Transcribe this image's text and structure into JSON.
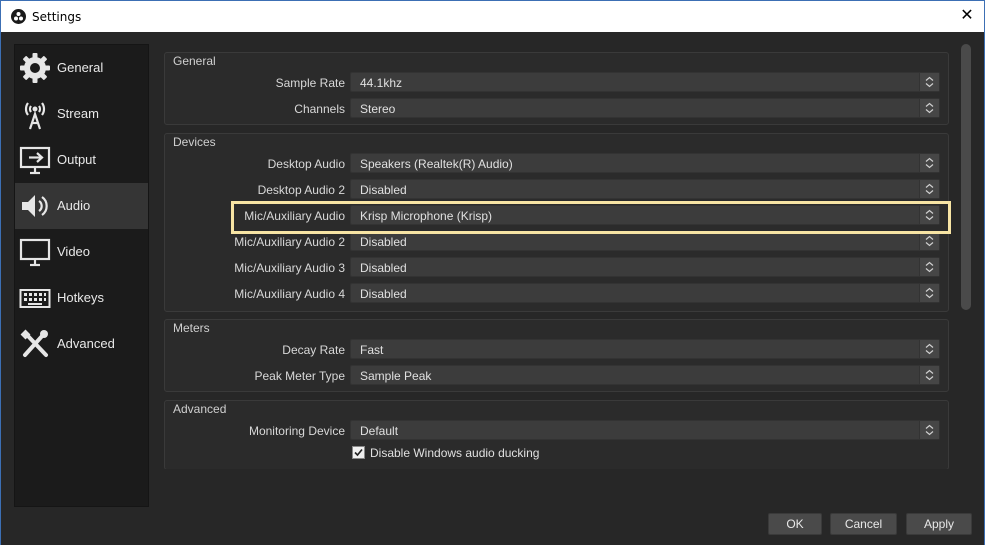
{
  "window": {
    "title": "Settings"
  },
  "sidebar": {
    "items": [
      {
        "label": "General",
        "icon": "gear-icon",
        "active": false
      },
      {
        "label": "Stream",
        "icon": "antenna-icon",
        "active": false
      },
      {
        "label": "Output",
        "icon": "output-icon",
        "active": false
      },
      {
        "label": "Audio",
        "icon": "speaker-icon",
        "active": true
      },
      {
        "label": "Video",
        "icon": "monitor-icon",
        "active": false
      },
      {
        "label": "Hotkeys",
        "icon": "keyboard-icon",
        "active": false
      },
      {
        "label": "Advanced",
        "icon": "tools-icon",
        "active": false
      }
    ]
  },
  "groups": {
    "general": {
      "title": "General",
      "rows": [
        {
          "label": "Sample Rate",
          "value": "44.1khz"
        },
        {
          "label": "Channels",
          "value": "Stereo"
        }
      ]
    },
    "devices": {
      "title": "Devices",
      "rows": [
        {
          "label": "Desktop Audio",
          "value": "Speakers (Realtek(R) Audio)"
        },
        {
          "label": "Desktop Audio 2",
          "value": "Disabled"
        },
        {
          "label": "Mic/Auxiliary Audio",
          "value": "Krisp Microphone (Krisp)"
        },
        {
          "label": "Mic/Auxiliary Audio 2",
          "value": "Disabled"
        },
        {
          "label": "Mic/Auxiliary Audio 3",
          "value": "Disabled"
        },
        {
          "label": "Mic/Auxiliary Audio 4",
          "value": "Disabled"
        }
      ]
    },
    "meters": {
      "title": "Meters",
      "rows": [
        {
          "label": "Decay Rate",
          "value": "Fast"
        },
        {
          "label": "Peak Meter Type",
          "value": "Sample Peak"
        }
      ]
    },
    "advanced": {
      "title": "Advanced",
      "rows": [
        {
          "label": "Monitoring Device",
          "value": "Default"
        }
      ],
      "checkbox": {
        "label": "Disable Windows audio ducking",
        "checked": true
      }
    }
  },
  "buttons": {
    "ok": "OK",
    "cancel": "Cancel",
    "apply": "Apply"
  },
  "colors": {
    "highlight": "#f7e4a4",
    "background": "#272727",
    "sidebar": "#1b1b1b"
  }
}
